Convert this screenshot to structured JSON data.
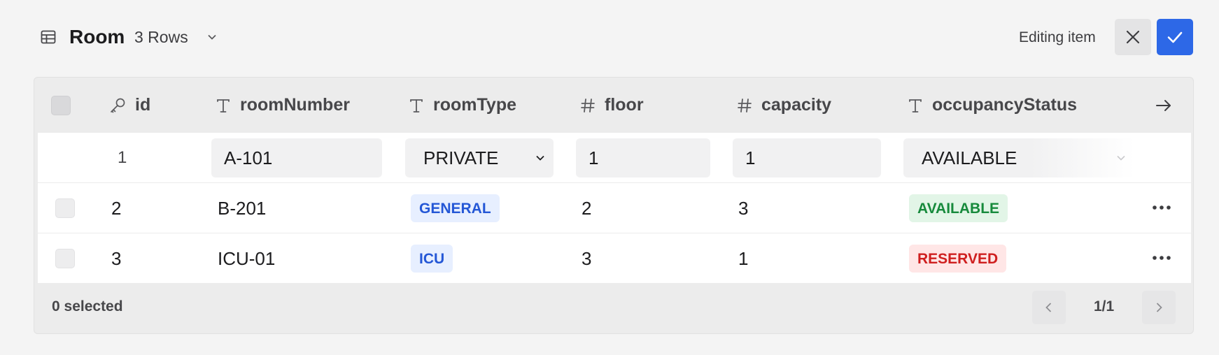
{
  "header": {
    "table_icon": "table-icon",
    "title": "Room",
    "rows_label": "3 Rows",
    "rows_chevron_icon": "chevron-down-icon",
    "editing_label": "Editing item",
    "close_icon": "close-icon",
    "confirm_icon": "check-icon",
    "accent_color": "#2d68e7"
  },
  "table": {
    "columns": [
      {
        "name": "id",
        "type_icon": "key-icon"
      },
      {
        "name": "roomNumber",
        "type_icon": "text-type-icon"
      },
      {
        "name": "roomType",
        "type_icon": "text-type-icon"
      },
      {
        "name": "floor",
        "type_icon": "number-type-icon"
      },
      {
        "name": "capacity",
        "type_icon": "number-type-icon"
      },
      {
        "name": "occupancyStatus",
        "type_icon": "text-type-icon"
      }
    ],
    "scroll_right_icon": "arrow-right-icon",
    "editing_row": {
      "id": "1",
      "roomNumber": "A-101",
      "roomType": "PRIVATE",
      "floor": "1",
      "capacity": "1",
      "occupancyStatus": "AVAILABLE"
    },
    "rows": [
      {
        "id": "2",
        "roomNumber": "B-201",
        "roomType": "GENERAL",
        "floor": "2",
        "capacity": "3",
        "occupancyStatus": "AVAILABLE",
        "status_color": "#178a3c",
        "type_color": "#2457d6"
      },
      {
        "id": "3",
        "roomNumber": "ICU-01",
        "roomType": "ICU",
        "floor": "3",
        "capacity": "1",
        "occupancyStatus": "RESERVED",
        "status_color": "#cf1f1f",
        "type_color": "#2457d6"
      }
    ],
    "row_menu_icon": "more-horizontal-icon"
  },
  "footer": {
    "selected_label": "0 selected",
    "page_label": "1/1",
    "prev_icon": "chevron-left-icon",
    "next_icon": "chevron-right-icon"
  }
}
